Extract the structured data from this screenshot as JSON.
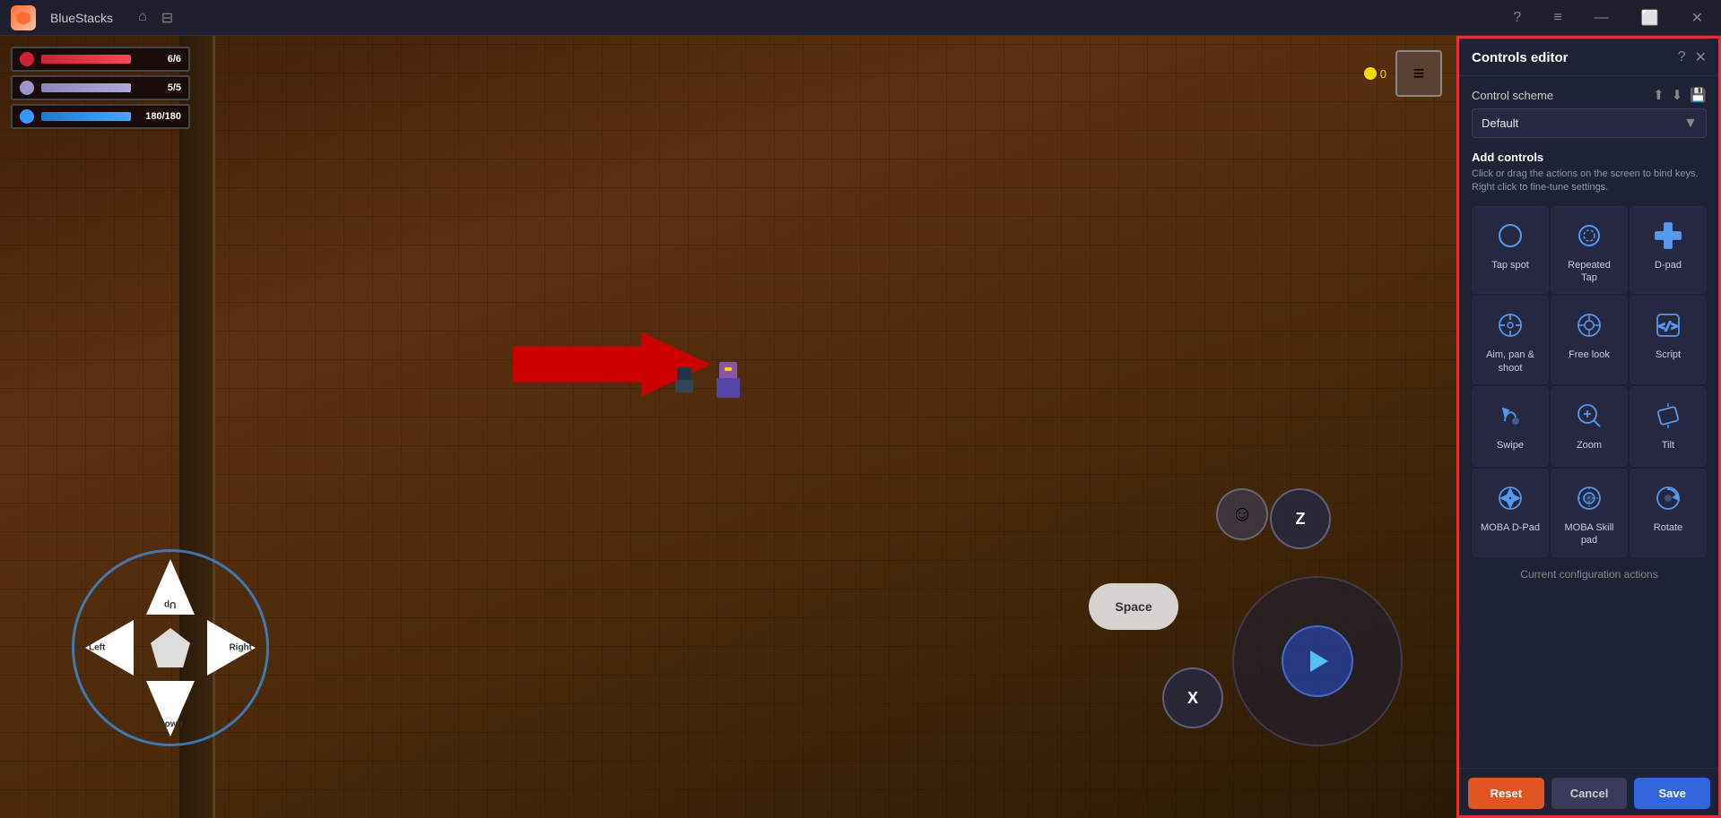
{
  "titleBar": {
    "appName": "BlueStacks",
    "homeIcon": "🏠",
    "windowIcon": "⊟",
    "helpIcon": "?",
    "menuIcon": "≡",
    "minimizeIcon": "—",
    "maximizeIcon": "⬜",
    "closeIcon": "✕"
  },
  "hud": {
    "hp": "6/6",
    "shield": "5/5",
    "mana": "180/180",
    "coins": "0",
    "hpPercent": 100,
    "shieldPercent": 100,
    "manaPercent": 100
  },
  "dpad": {
    "up": "Up",
    "down": "Down",
    "left": "Left",
    "right": "Right"
  },
  "actionButtons": {
    "spaceLabel": "Space",
    "zLabel": "Z",
    "xLabel": "X"
  },
  "controlsPanel": {
    "title": "Controls editor",
    "helpIcon": "?",
    "closeIcon": "✕",
    "schemeLabel": "Control scheme",
    "importIcon": "⬆",
    "exportIcon": "⬇",
    "saveSchemeIcon": "💾",
    "schemeDefault": "Default",
    "addControlsTitle": "Add controls",
    "addControlsDesc": "Click or drag the actions on the screen to bind keys. Right click to fine-tune settings.",
    "controls": [
      {
        "id": "tap-spot",
        "label": "Tap spot",
        "iconType": "circle"
      },
      {
        "id": "repeated-tap",
        "label": "Repeated Tap",
        "iconType": "repeated-circle"
      },
      {
        "id": "d-pad",
        "label": "D-pad",
        "iconType": "dpad"
      },
      {
        "id": "aim-pan-shoot",
        "label": "Aim, pan & shoot",
        "iconType": "crosshair"
      },
      {
        "id": "free-look",
        "label": "Free look",
        "iconType": "eye-circle"
      },
      {
        "id": "script",
        "label": "Script",
        "iconType": "code"
      },
      {
        "id": "swipe",
        "label": "Swipe",
        "iconType": "swipe"
      },
      {
        "id": "zoom",
        "label": "Zoom",
        "iconType": "zoom"
      },
      {
        "id": "tilt",
        "label": "Tilt",
        "iconType": "tilt"
      },
      {
        "id": "moba-dpad",
        "label": "MOBA D-Pad",
        "iconType": "moba-dpad"
      },
      {
        "id": "moba-skill-pad",
        "label": "MOBA Skill pad",
        "iconType": "moba-skill"
      },
      {
        "id": "rotate",
        "label": "Rotate",
        "iconType": "rotate"
      }
    ],
    "configActionsLabel": "Current configuration actions",
    "resetLabel": "Reset",
    "cancelLabel": "Cancel",
    "saveLabel": "Save"
  }
}
